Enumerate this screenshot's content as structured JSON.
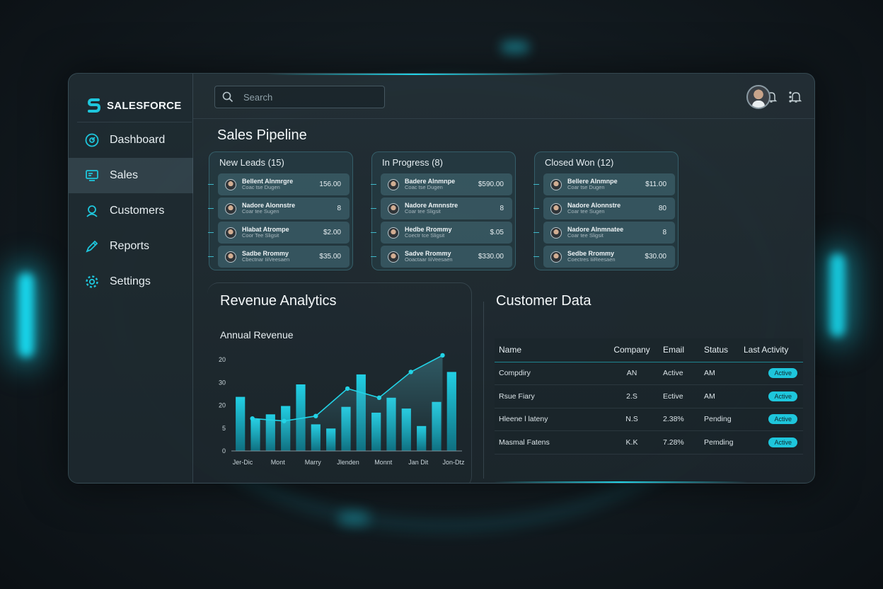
{
  "app": {
    "brand": "SALESFORCE"
  },
  "colors": {
    "accent": "#1ec6dc",
    "background": "#121a1f",
    "panel": "#1f2b31"
  },
  "sidebar": {
    "items": [
      {
        "label": "Dashboard",
        "icon": "dashboard-icon"
      },
      {
        "label": "Sales",
        "icon": "sales-icon",
        "active": true
      },
      {
        "label": "Customers",
        "icon": "customers-icon"
      },
      {
        "label": "Reports",
        "icon": "reports-icon"
      },
      {
        "label": "Settings",
        "icon": "settings-icon"
      }
    ]
  },
  "header": {
    "search_placeholder": "Search",
    "icons": [
      "bell-icon",
      "bell-icon",
      "avatar",
      "more-vertical-icon"
    ]
  },
  "pipeline": {
    "title": "Sales Pipeline",
    "columns": [
      {
        "title": "New Leads (15)",
        "cards": [
          {
            "name": "Bellent Alnmrgre",
            "sub": "Coac tse Dugen",
            "value": "156.00"
          },
          {
            "name": "Nadore Alonnstre",
            "sub": "Coar tee Sugen",
            "value": "8"
          },
          {
            "name": "Hlabat Atrompe",
            "sub": "Coor Tee Sligsit",
            "value": "$2.00"
          },
          {
            "name": "Sadbe Rrommy",
            "sub": "Cbectnar IiiVeesaen",
            "value": "$35.00"
          }
        ]
      },
      {
        "title": "In Progress (8)",
        "cards": [
          {
            "name": "Badere Alnmnpe",
            "sub": "Coac tse Dugen",
            "value": "$590.00"
          },
          {
            "name": "Nadore Amnnstre",
            "sub": "Coar tee Sligsit",
            "value": "8"
          },
          {
            "name": "Hedbe Rrommy",
            "sub": "Coectr tce Sligsit",
            "value": "$.05"
          },
          {
            "name": "Sadve Rrommy",
            "sub": "Ooactaar IiiVeesaen",
            "value": "$330.00"
          }
        ]
      },
      {
        "title": "Closed Won (12)",
        "cards": [
          {
            "name": "Bellere Alnmnpe",
            "sub": "Coar tse Dugen",
            "value": "$11.00"
          },
          {
            "name": "Nadore Alonnstre",
            "sub": "Coar tee Sugen",
            "value": "80"
          },
          {
            "name": "Nadore Alnmnatee",
            "sub": "Coar tee Sligsit",
            "value": "8"
          },
          {
            "name": "Sedbe Rrommy",
            "sub": "Coectres IiiReesaen",
            "value": "$30.00"
          }
        ]
      }
    ]
  },
  "revenue": {
    "title": "Revenue Analytics",
    "subtitle": "Annual Revenue"
  },
  "chart_data": {
    "type": "bar",
    "title": "Annual Revenue",
    "y_ticks": [
      "0",
      "5",
      "20",
      "30",
      "20"
    ],
    "x_labels": [
      "Jer-Dic",
      "Mont",
      "Marry",
      "Jlenden",
      "Monnt",
      "Jan Dit",
      "Jon-Dtz"
    ],
    "bars": [
      0.65,
      0.38,
      0.44,
      0.54,
      0.8,
      0.32,
      0.27,
      0.53,
      0.92,
      0.46,
      0.64,
      0.51,
      0.3,
      0.59,
      0.95
    ],
    "line": [
      0.39,
      0.36,
      0.42,
      0.75,
      0.64,
      0.95,
      1.15
    ],
    "ylim": [
      0,
      1.2
    ],
    "grid": false
  },
  "customers": {
    "title": "Customer Data",
    "columns": [
      "Name",
      "Company",
      "Email",
      "Status",
      "Last Activity"
    ],
    "rows": [
      {
        "name": "Compdiry",
        "company": "AN",
        "email": "Active",
        "status": "AM",
        "activity": "Active"
      },
      {
        "name": "Rsue Fiary",
        "company": "2.S",
        "email": "Ective",
        "status": "AM",
        "activity": "Active"
      },
      {
        "name": "Hleene l lateny",
        "company": "N.S",
        "email": "2.38%",
        "status": "Pending",
        "activity": "Active"
      },
      {
        "name": "Masmal Fatens",
        "company": "K.K",
        "email": "7.28%",
        "status": "Pemding",
        "activity": "Active"
      }
    ]
  }
}
